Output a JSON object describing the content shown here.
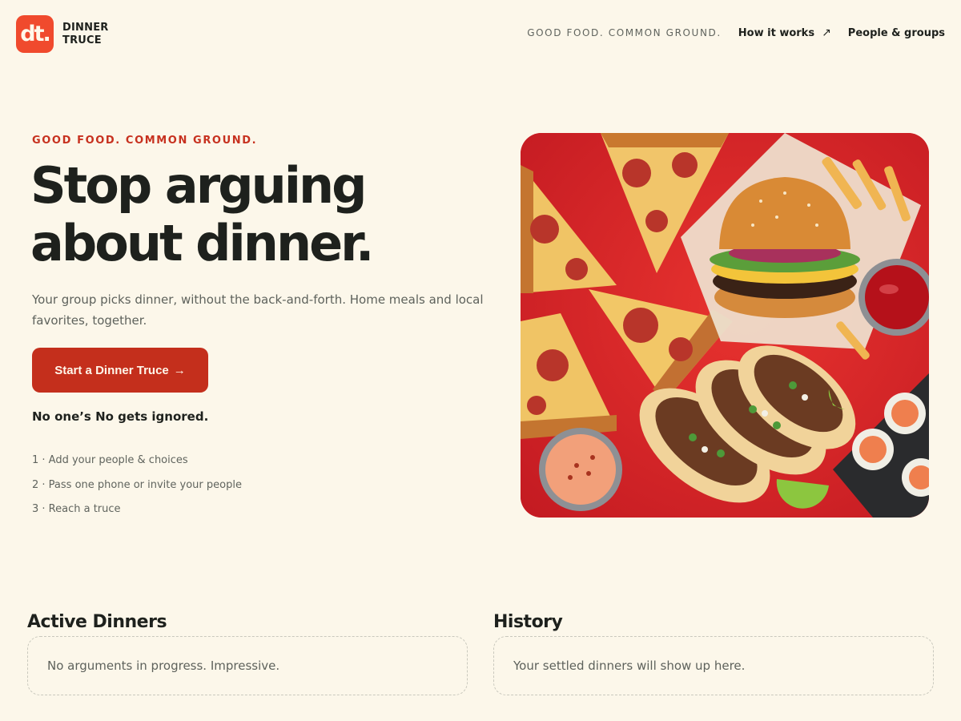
{
  "brand": {
    "logo_mark": "dt.",
    "name_line1": "DINNER",
    "name_line2": "TRUCE",
    "accent_color": "#f04a2d"
  },
  "topnav": {
    "tagline": "GOOD FOOD. COMMON GROUND.",
    "how_it_works": "How it works",
    "how_it_works_icon": "arrow-up-right-icon",
    "people_groups": "People & groups"
  },
  "hero": {
    "eyebrow": "GOOD FOOD. COMMON GROUND.",
    "headline_line1": "Stop arguing",
    "headline_line2": "about dinner.",
    "subtitle": "Your group picks dinner, without the back-and-forth. Home meals and local favorites, together.",
    "cta_label": "Start a Dinner Truce",
    "cta_arrow": "→",
    "cta_color": "#c42f1c",
    "promise": "No one’s No gets ignored.",
    "steps": [
      "1 · Add your people & choices",
      "2 · Pass one phone or invite your people",
      "3 · Reach a truce"
    ],
    "image_icon": "food-spread-photo"
  },
  "active_dinners": {
    "title": "Active Dinners",
    "empty_text": "No arguments in progress. Impressive."
  },
  "history": {
    "title": "History",
    "empty_text": "Your settled dinners will show up here."
  },
  "colors": {
    "background": "#fcf7ea",
    "text_dark": "#1e211d",
    "text_muted": "#5e625c",
    "eyebrow_red": "#c7311f"
  }
}
